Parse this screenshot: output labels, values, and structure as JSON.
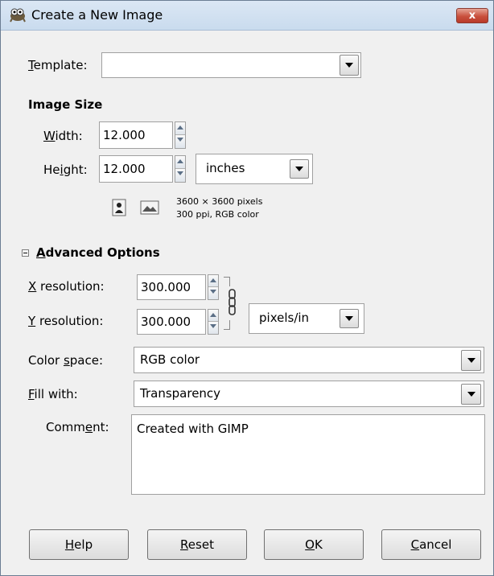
{
  "window": {
    "title": "Create a New Image",
    "close_label": "x"
  },
  "template": {
    "label": "Template:",
    "value": ""
  },
  "image_size": {
    "heading": "Image Size",
    "width_label": "Width:",
    "width_value": "12.000",
    "height_label": "Height:",
    "height_value": "12.000",
    "unit": "inches",
    "info_line1": "3600 × 3600 pixels",
    "info_line2": "300 ppi, RGB color"
  },
  "advanced": {
    "heading": "Advanced Options",
    "x_res_label": "X resolution:",
    "x_res_value": "300.000",
    "y_res_label": "Y resolution:",
    "y_res_value": "300.000",
    "res_unit": "pixels/in",
    "color_space_label": "Color space:",
    "color_space_value": "RGB color",
    "fill_label": "Fill with:",
    "fill_value": "Transparency",
    "comment_label": "Comment:",
    "comment_value": "Created with GIMP"
  },
  "buttons": {
    "help": "Help",
    "reset": "Reset",
    "ok": "OK",
    "cancel": "Cancel"
  }
}
